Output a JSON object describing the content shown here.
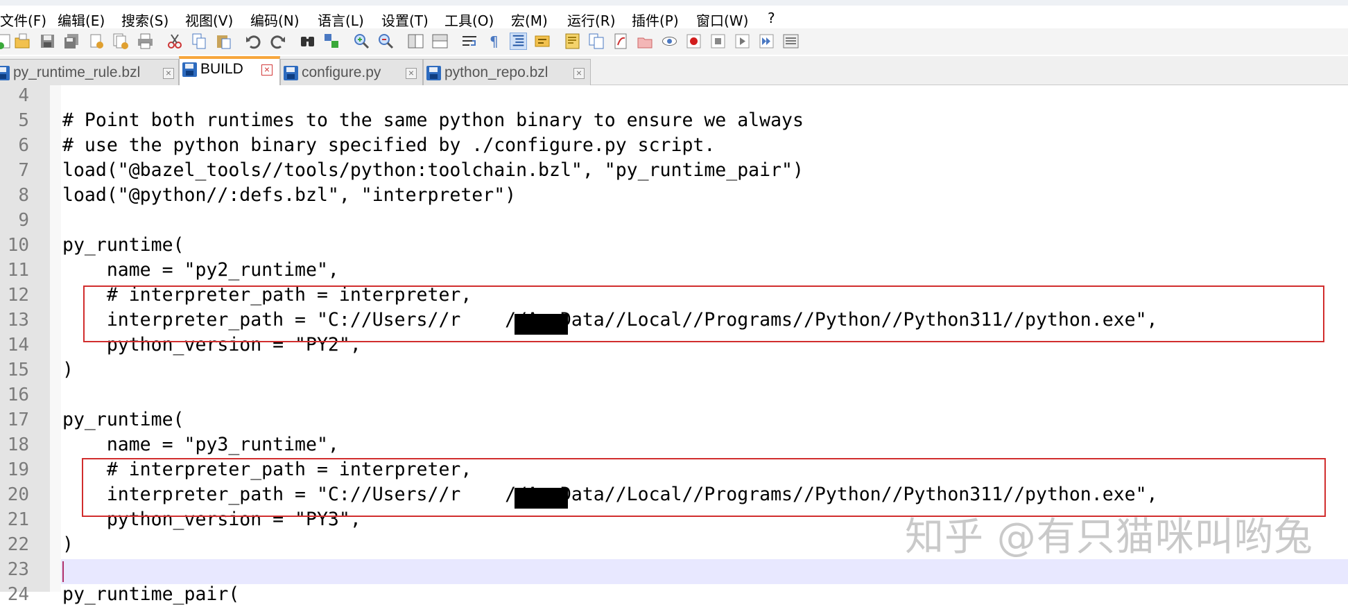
{
  "menu": [
    "文件(F)",
    "编辑(E)",
    "搜索(S)",
    "视图(V)",
    "编码(N)",
    "语言(L)",
    "设置(T)",
    "工具(O)",
    "宏(M)",
    "运行(R)",
    "插件(P)",
    "窗口(W)",
    "?"
  ],
  "toolbar_icons": [
    "new-file-icon",
    "open-file-icon",
    "save-icon",
    "save-all-icon",
    "close-icon",
    "close-all-icon",
    "print-icon",
    "cut-icon",
    "copy-icon",
    "paste-icon",
    "undo-icon",
    "redo-icon",
    "find-icon",
    "replace-icon",
    "zoom-in-icon",
    "zoom-out-icon",
    "sync-vertical-icon",
    "sync-horizontal-icon",
    "word-wrap-icon",
    "show-all-chars-icon",
    "indent-guide-icon",
    "define-language-icon",
    "doc-map-icon",
    "function-list-icon",
    "folder-as-workspace-icon",
    "monitoring-icon",
    "record-macro-icon",
    "stop-record-icon",
    "play-macro-icon",
    "run-macro-multiple-icon",
    "save-macro-icon"
  ],
  "tabs": [
    {
      "label": "py_runtime_rule.bzl",
      "active": false
    },
    {
      "label": "BUILD",
      "active": true
    },
    {
      "label": "configure.py",
      "active": false
    },
    {
      "label": "python_repo.bzl",
      "active": false
    }
  ],
  "editor": {
    "lines": [
      {
        "num": "4",
        "text": ""
      },
      {
        "num": "5",
        "text": "# Point both runtimes to the same python binary to ensure we always"
      },
      {
        "num": "6",
        "text": "# use the python binary specified by ./configure.py script."
      },
      {
        "num": "7",
        "text": "load(\"@bazel_tools//tools/python:toolchain.bzl\", \"py_runtime_pair\")"
      },
      {
        "num": "8",
        "text": "load(\"@python//:defs.bzl\", \"interpreter\")"
      },
      {
        "num": "9",
        "text": ""
      },
      {
        "num": "10",
        "text": "py_runtime("
      },
      {
        "num": "11",
        "text": "    name = \"py2_runtime\","
      },
      {
        "num": "12",
        "text": "    # interpreter_path = interpreter,"
      },
      {
        "num": "13",
        "text": "    interpreter_path = \"C://Users//r    //AppData//Local//Programs//Python//Python311//python.exe\","
      },
      {
        "num": "14",
        "text": "    python_version = \"PY2\","
      },
      {
        "num": "15",
        "text": ")"
      },
      {
        "num": "16",
        "text": ""
      },
      {
        "num": "17",
        "text": "py_runtime("
      },
      {
        "num": "18",
        "text": "    name = \"py3_runtime\","
      },
      {
        "num": "19",
        "text": "    # interpreter_path = interpreter,"
      },
      {
        "num": "20",
        "text": "    interpreter_path = \"C://Users//r    //AppData//Local//Programs//Python//Python311//python.exe\","
      },
      {
        "num": "21",
        "text": "    python_version = \"PY3\","
      },
      {
        "num": "22",
        "text": ")"
      },
      {
        "num": "23",
        "text": ""
      },
      {
        "num": "24",
        "text": "py_runtime_pair("
      }
    ]
  },
  "watermark": "知乎 @有只猫咪叫哟兔",
  "colors": {
    "highlight_box": "#d12d2d",
    "active_tab_accent": "#f7a63c",
    "current_line": "#e8e8ff"
  }
}
